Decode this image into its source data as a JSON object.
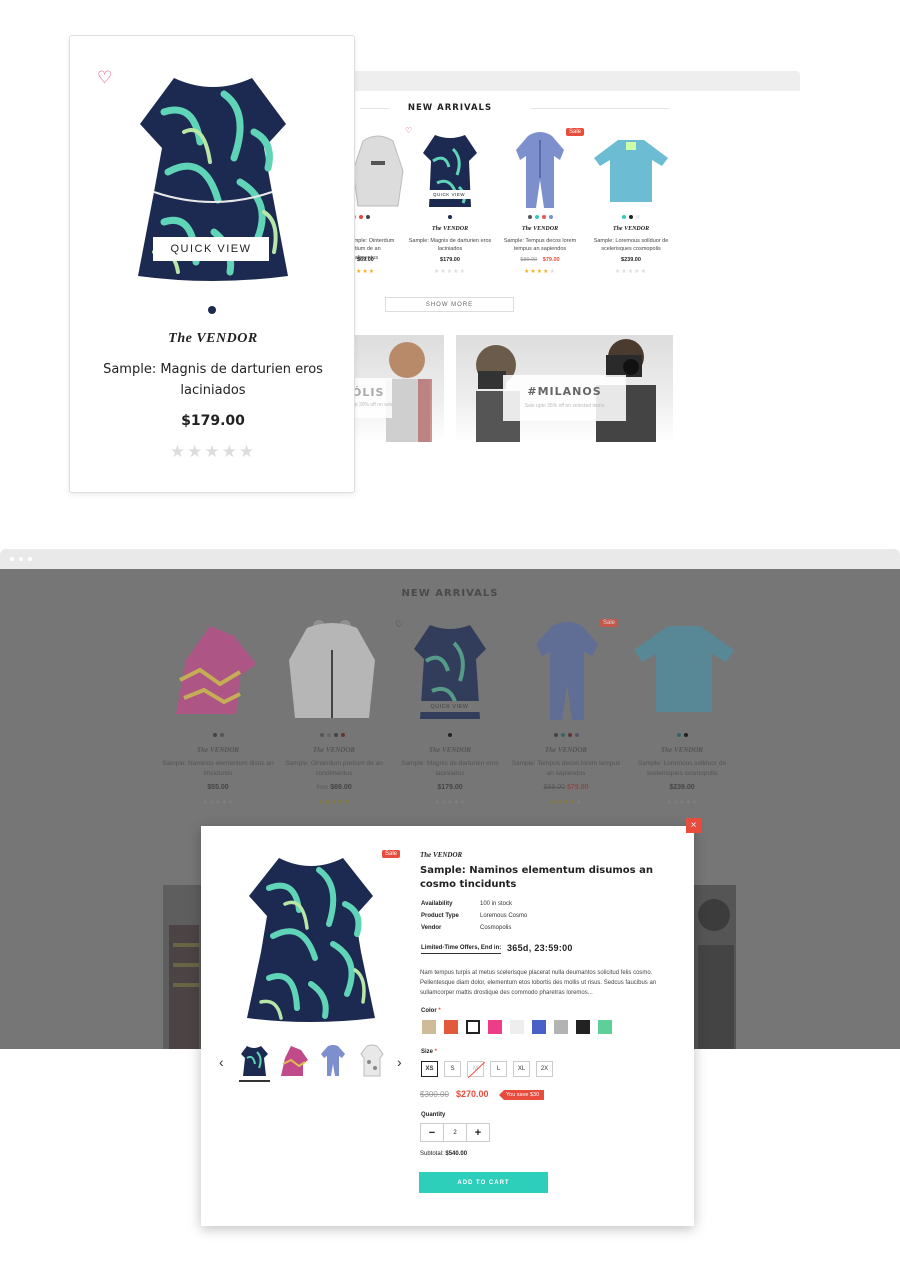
{
  "top": {
    "title": "NEW ARRIVALS",
    "products": [
      {
        "vendor": "The VENDOR",
        "name": "Sample: Ointerdum pretium de an condimentus",
        "price": "$69.00",
        "rating": 5
      },
      {
        "vendor": "The VENDOR",
        "name": "Sample: Magnis de darturien eros laciniados",
        "price": "$179.00",
        "rating": 0
      },
      {
        "vendor": "The VENDOR",
        "name": "Sample: Tempus decos lorem tempus an sapiendos",
        "old_price": "$89.00",
        "price": "$79.00",
        "rating": 4,
        "badge": "Sale"
      },
      {
        "vendor": "The VENDOR",
        "name": "Sample: Loremous sollduor de scelerisques cosmopolis",
        "price": "$239.00",
        "rating": 0
      }
    ],
    "quick_view": "QUICK VIEW",
    "show_more": "SHOW MORE",
    "banners": [
      {
        "title": "ÓLIS",
        "sub": "up 30% off on selected items"
      },
      {
        "title": "#MILANOS",
        "sub": "Sale upto 35% off on selected items"
      }
    ]
  },
  "big_card": {
    "quick_view": "QUICK VIEW",
    "vendor": "The VENDOR",
    "name": "Sample: Magnis de darturien eros laciniados",
    "price": "$179.00",
    "rating": 0
  },
  "bottom": {
    "title": "NEW ARRIVALS",
    "products": [
      {
        "vendor": "The VENDOR",
        "name": "Sample: Naminos elementum disus an tinciduntis",
        "price": "$55.00"
      },
      {
        "vendor": "The VENDOR",
        "name": "Sample: Ointerdum pretium de an condimentus",
        "price_prefix": "from",
        "price": "$69.00"
      },
      {
        "vendor": "The VENDOR",
        "name": "Sample: Magnis de darturien eros laciniados",
        "price": "$179.00"
      },
      {
        "vendor": "The VENDOR",
        "name": "Sample: Tempus decos lorem tempus an sapiendos",
        "old_price": "$89.00",
        "price": "$79.00",
        "badge": "Sale"
      },
      {
        "vendor": "The VENDOR",
        "name": "Sample: Loremous sollduor de scelerisques cosmopolis",
        "price": "$239.00"
      }
    ],
    "quick_view": "QUICK VIEW"
  },
  "modal": {
    "close": "×",
    "badge": "Sale",
    "vendor": "The VENDOR",
    "title": "Sample: Naminos elementum disumos an cosmo tincidunts",
    "specs": [
      {
        "label": "Availability",
        "value": "100 in stock"
      },
      {
        "label": "Product Type",
        "value": "Loremous Cosmo"
      },
      {
        "label": "Vendor",
        "value": "Cosmopolis"
      }
    ],
    "offer_label": "Limited-Time Offers, End in:",
    "countdown": "365d, 23:59:00",
    "description": "Nam tempus turpis at metus scelerisque placerat nulla deumantos solicitud felis cosmo. Pellentesque diam dolor, elementum etos lobortis des mollis ut risus. Sedcus faucibus an sullamcorper mattis drostique des commodo pharetras loremos...",
    "color_label": "Color",
    "colors": [
      "#cdbb99",
      "#e3593b",
      "#ffffff",
      "#ec3d86",
      "#eeeeee",
      "#4961c7",
      "#b3b3b3",
      "#222222",
      "#5fcf9a"
    ],
    "size_label": "Size",
    "sizes": [
      "XS",
      "S",
      "M",
      "L",
      "XL",
      "2X"
    ],
    "selected_size": "XS",
    "old_price": "$300.00",
    "price": "$270.00",
    "save_badge": "You save $30",
    "quantity_label": "Quantity",
    "quantity": "2",
    "subtotal_label": "Subtotal:",
    "subtotal": "$540.00",
    "add_to_cart": "ADD TO CART"
  }
}
